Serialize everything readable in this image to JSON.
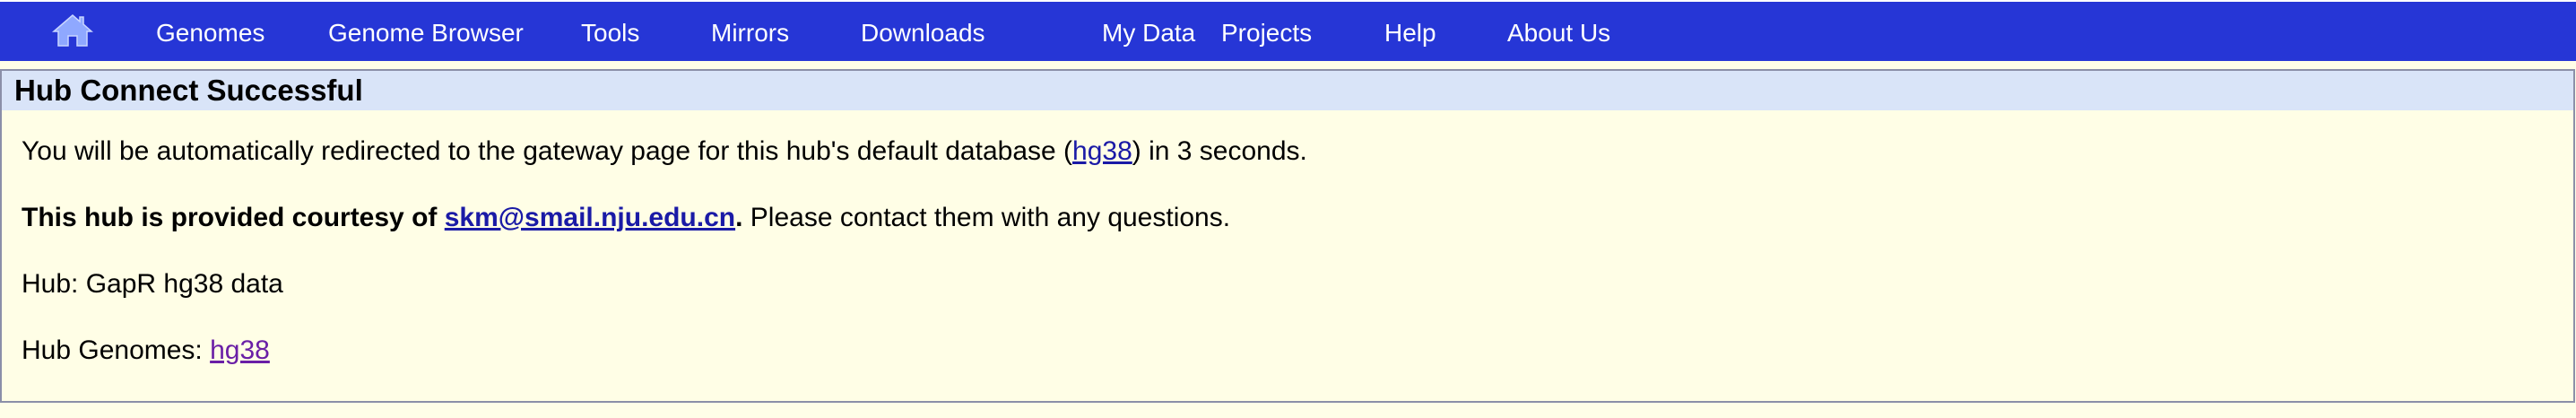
{
  "nav": {
    "home_icon": "home-icon",
    "items": [
      {
        "label": "Genomes"
      },
      {
        "label": "Genome Browser"
      },
      {
        "label": "Tools"
      },
      {
        "label": "Mirrors"
      },
      {
        "label": "Downloads"
      },
      {
        "label": "My Data"
      },
      {
        "label": "Projects"
      },
      {
        "label": "Help"
      },
      {
        "label": "About Us"
      }
    ]
  },
  "panel": {
    "title": "Hub Connect Successful",
    "redirect": {
      "prefix": "You will be automatically redirected to the gateway page for this hub's default database (",
      "db_link": "hg38",
      "suffix": ") in 3 seconds."
    },
    "courtesy": {
      "prefix": "This hub is provided courtesy of ",
      "email": "skm@smail.nju.edu.cn",
      "period": ".",
      "suffix": " Please contact them with any questions."
    },
    "hub": {
      "label": "Hub: GapR hg38 data"
    },
    "genomes": {
      "label": "Hub Genomes: ",
      "link": "hg38"
    }
  },
  "colors": {
    "nav_bg": "#2636d6",
    "header_bg": "#d9e4f8",
    "page_bg": "#fffee6",
    "link": "#1a1aa6",
    "visited_link": "#6a1fa6"
  }
}
